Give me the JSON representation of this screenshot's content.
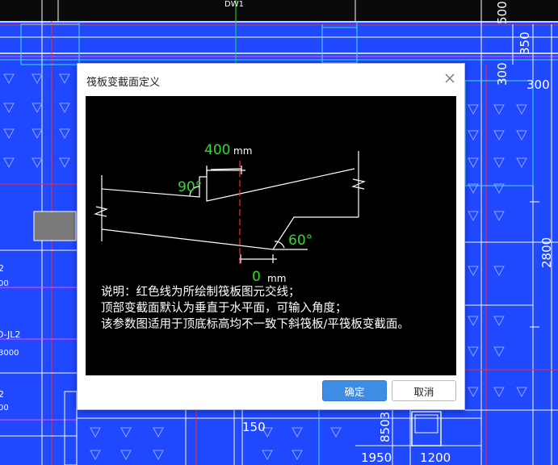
{
  "background": {
    "labels": {
      "top_mark": "DW1",
      "dim_500": "500",
      "dim_350": "350",
      "dim_300_v": "300",
      "dim_300_h": "300",
      "dim_2800": "2800",
      "dim_150": "150",
      "dim_8503": "8503",
      "dim_1950": "1950",
      "dim_1200": "1200",
      "left_2a": "2",
      "left_00a": "00",
      "left_jl2": "D-JL2",
      "left_3000": "3000",
      "left_2b": "2",
      "left_00b": "00"
    },
    "colors": {
      "canvas": "#1f48ff",
      "line_white": "#ffffff",
      "line_red": "#ff2a2a",
      "line_cyan": "#43e0ff",
      "line_magenta": "#ff4cff"
    }
  },
  "dialog": {
    "title": "筏板变截面定义",
    "close_icon": "close-icon",
    "preview": {
      "dim_top_value": "400",
      "dim_top_unit": "mm",
      "angle_top": "90°",
      "angle_bottom": "60°",
      "dim_bottom_value": "0",
      "dim_bottom_unit": "mm",
      "note_line1": "说明：红色线为所绘制筏板图元交线；",
      "note_line2": "顶部变截面默认为垂直于水平面，可输入角度；",
      "note_line3": "该参数图适用于顶底标高均不一致下斜筏板/平筏板变截面。",
      "colors": {
        "line": "#ffffff",
        "red_axis": "#ff2a2a",
        "dim_text": "#2bdc2b"
      }
    },
    "buttons": {
      "ok": "确定",
      "cancel": "取消"
    }
  }
}
